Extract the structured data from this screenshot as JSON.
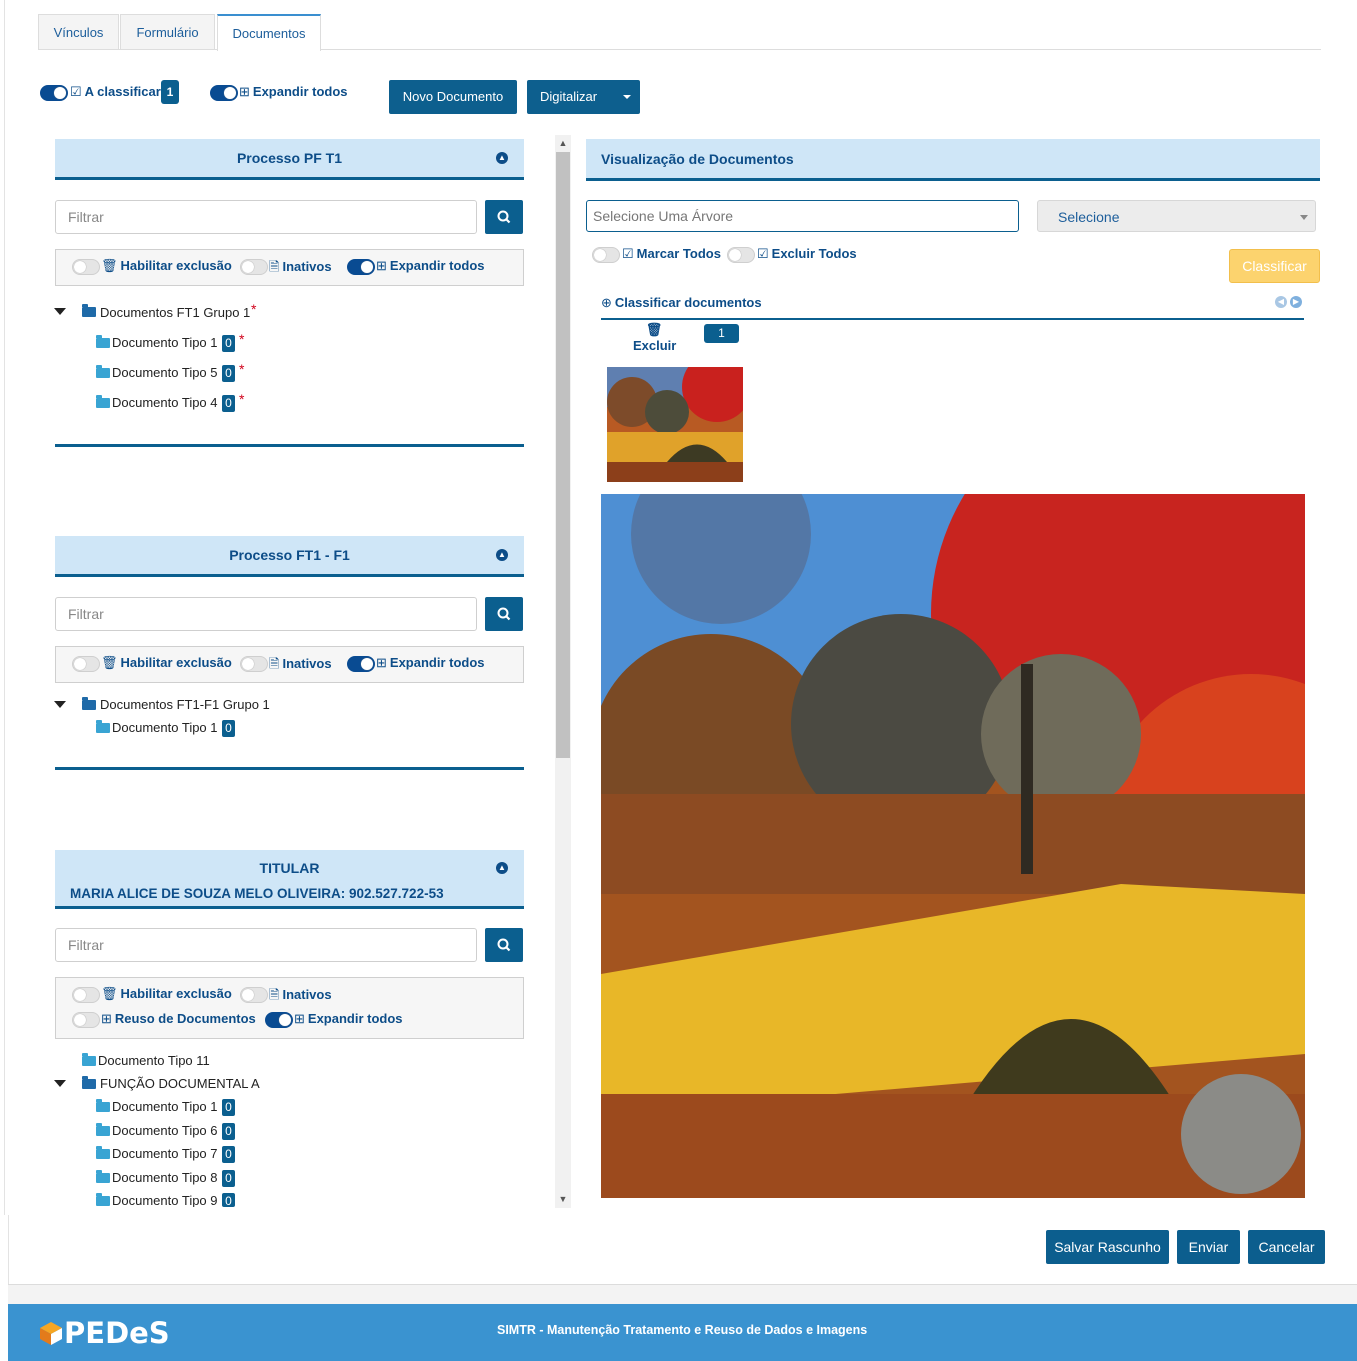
{
  "tabs": [
    {
      "label": "Vínculos",
      "active": false
    },
    {
      "label": "Formulário",
      "active": false
    },
    {
      "label": "Documentos",
      "active": true
    }
  ],
  "top_controls": {
    "a_classificar_label": "A classificar",
    "a_classificar_count": "1",
    "expandir_todos_label": "Expandir todos",
    "novo_documento_label": "Novo Documento",
    "digitalizar_label": "Digitalizar"
  },
  "common": {
    "filter_placeholder": "Filtrar",
    "habilitar_exclusao": "Habilitar exclusão",
    "inativos": "Inativos",
    "expandir_todos": "Expandir todos",
    "reuso_documentos": "Reuso de Documentos"
  },
  "panels": [
    {
      "title": "Processo PF T1",
      "group": "Documentos FT1 Grupo 1",
      "items": [
        {
          "label": "Documento Tipo 1",
          "count": "0"
        },
        {
          "label": "Documento Tipo 5",
          "count": "0"
        },
        {
          "label": "Documento Tipo 4",
          "count": "0"
        }
      ]
    },
    {
      "title": "Processo FT1 - F1",
      "group": "Documentos FT1-F1 Grupo 1",
      "items": [
        {
          "label": "Documento Tipo 1",
          "count": "0"
        }
      ]
    },
    {
      "title": "TITULAR",
      "subtitle": "MARIA ALICE DE SOUZA MELO OLIVEIRA: 902.527.722-53",
      "loose_item": "Documento Tipo 11",
      "group": "FUNÇÃO DOCUMENTAL A",
      "items": [
        {
          "label": "Documento Tipo 1",
          "count": "0"
        },
        {
          "label": "Documento Tipo 6",
          "count": "0"
        },
        {
          "label": "Documento Tipo 7",
          "count": "0"
        },
        {
          "label": "Documento Tipo 8",
          "count": "0"
        },
        {
          "label": "Documento Tipo 9",
          "count": "0"
        }
      ]
    }
  ],
  "viewer": {
    "title": "Visualização de Documentos",
    "tree_placeholder": "Selecione Uma Árvore",
    "select_value": "Selecione",
    "marcar_todos": "Marcar Todos",
    "excluir_todos": "Excluir Todos",
    "classificar_button": "Classificar",
    "classificar_documentos": "Classificar documentos",
    "excluir_label": "Excluir",
    "page_number": "1"
  },
  "footer_buttons": {
    "salvar": "Salvar Rascunho",
    "enviar": "Enviar",
    "cancelar": "Cancelar"
  },
  "footer": {
    "logo_text": "PEDeS",
    "system_prefix": "SIMTR",
    "system_text": " - Manutenção Tratamento e Reuso de Dados e Imagens"
  },
  "colors": {
    "primary": "#0b5f8f",
    "header_bg": "#cfe6f7",
    "footer_bg": "#3a93d0",
    "warning": "#fcd36e",
    "required": "#d0021b"
  },
  "icons": [
    "check-square-icon",
    "plus-square-icon",
    "search-icon",
    "trash-icon",
    "file-text-icon",
    "folder-icon",
    "folder-open-icon",
    "chevron-up-circle-icon",
    "caret-down-icon",
    "zoom-in-icon",
    "prev-circle-icon",
    "next-circle-icon"
  ]
}
